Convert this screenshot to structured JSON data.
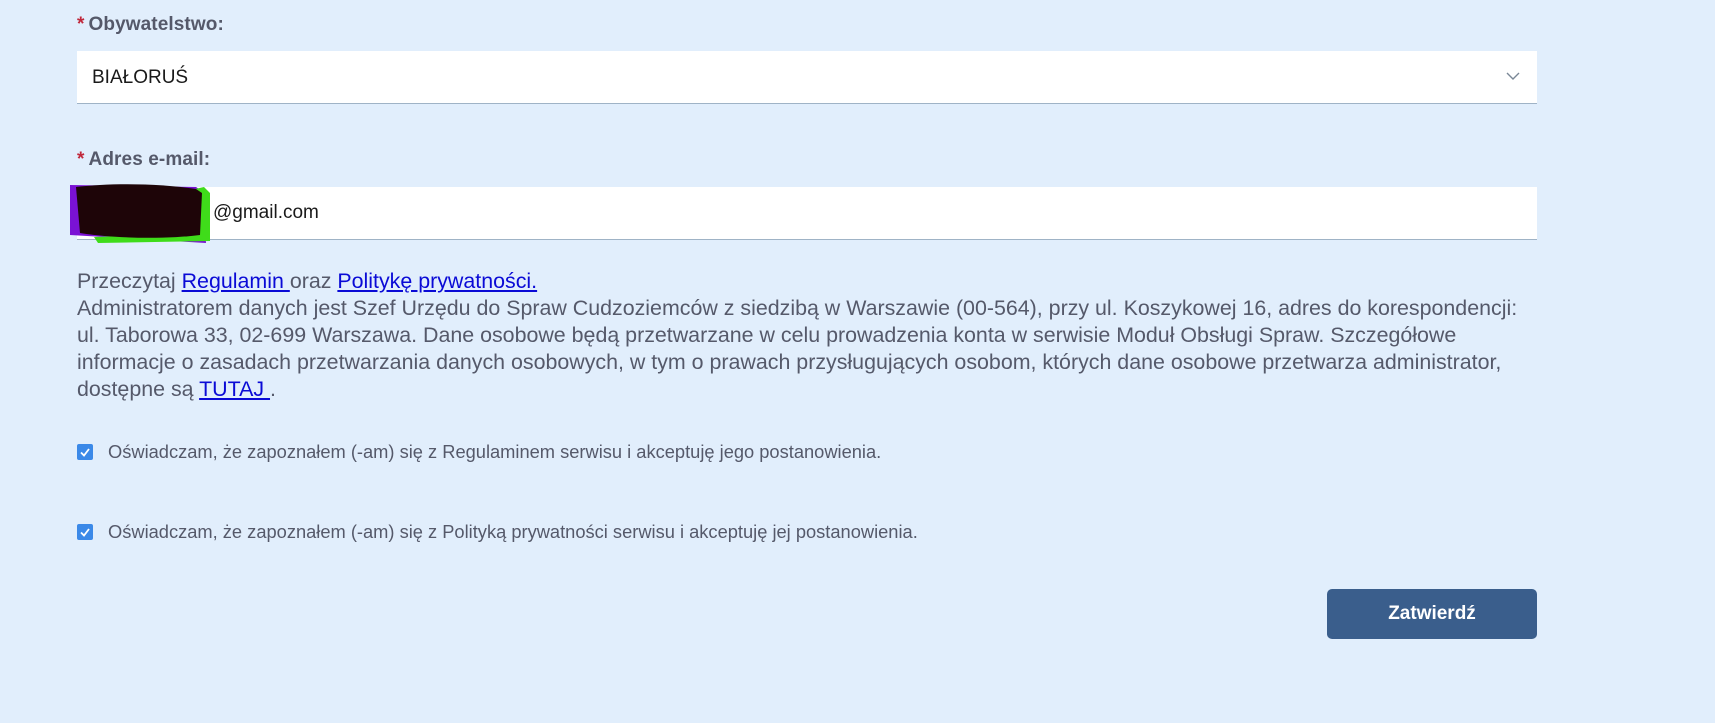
{
  "citizenship": {
    "required_mark": "*",
    "label": "Obywatelstwo:",
    "selected_value": "BIAŁORUŚ"
  },
  "email": {
    "required_mark": "*",
    "label": "Adres e-mail:",
    "visible_value": "@gmail.com"
  },
  "info": {
    "read_prefix": "Przeczytaj ",
    "terms_link": "Regulamin ",
    "and_text": "oraz ",
    "privacy_link": "Politykę prywatności.",
    "admin_text": "Administratorem danych jest Szef Urzędu do Spraw Cudzoziemców z siedzibą w Warszawie (00-564), przy ul. Koszykowej 16, adres do korespondencji: ul. Taborowa 33, 02-699 Warszawa. Dane osobowe będą przetwarzane w celu prowadzenia konta w serwisie Moduł Obsługi Spraw. Szczegółowe informacje o zasadach przetwarzania danych osobowych, w tym o prawach przysługujących osobom, których dane osobowe przetwarza administrator, dostępne są ",
    "here_link": "TUTAJ ",
    "end_text": "."
  },
  "checkboxes": [
    {
      "label": "Oświadczam, że zapoznałem (-am) się z Regulaminem serwisu i akceptuję jego postanowienia."
    },
    {
      "label": "Oświadczam, że zapoznałem (-am) się z Polityką prywatności serwisu i akceptuję jej postanowienia."
    }
  ],
  "submit": {
    "label": "Zatwierdź"
  },
  "colors": {
    "background": "#e1eefc",
    "required": "#c0283b",
    "link": "#0a0ad6",
    "checkbox": "#3b89e8",
    "button": "#3a5e8c"
  }
}
